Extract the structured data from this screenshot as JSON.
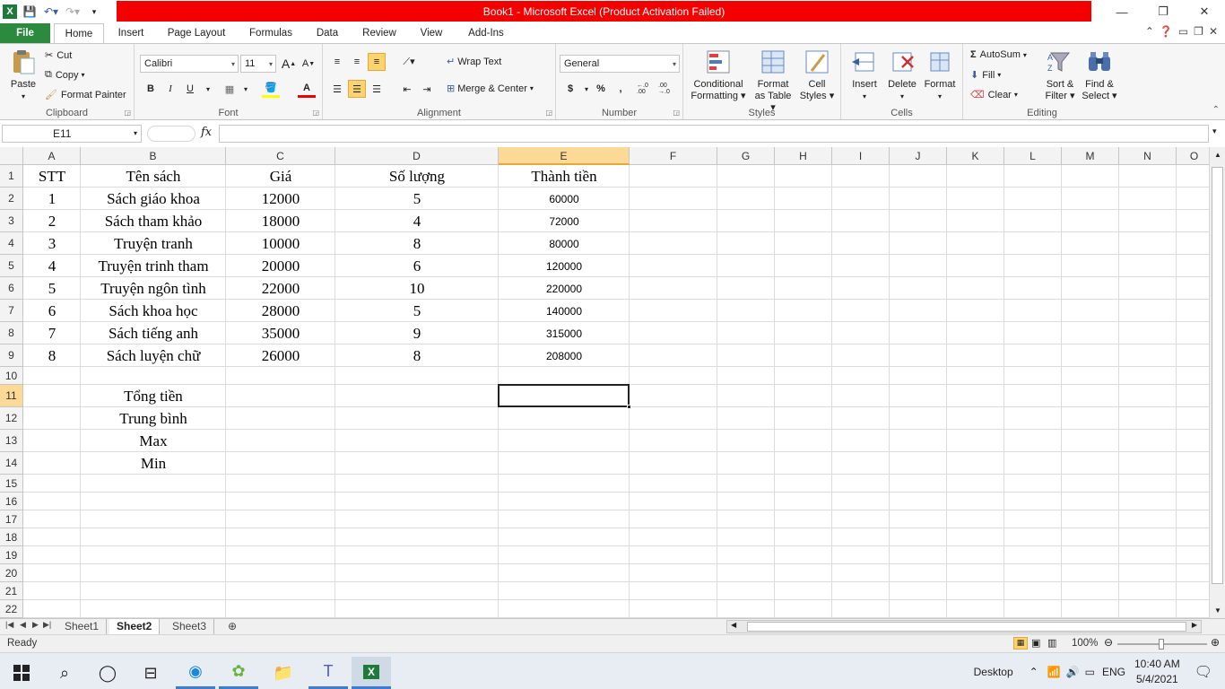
{
  "window": {
    "title": "Book1 - Microsoft Excel (Product Activation Failed)",
    "title_bar_color": "#f40000",
    "minimize": "—",
    "restore": "❐",
    "close": "✕"
  },
  "ribbon_tabs": [
    "File",
    "Home",
    "Insert",
    "Page Layout",
    "Formulas",
    "Data",
    "Review",
    "View",
    "Add-Ins"
  ],
  "active_tab": "Home",
  "clipboard": {
    "label": "Clipboard",
    "paste": "Paste",
    "cut": "Cut",
    "copy": "Copy",
    "format_painter": "Format Painter"
  },
  "font": {
    "label": "Font",
    "name": "Calibri",
    "size": "11",
    "bold": "B",
    "italic": "I",
    "underline": "U",
    "grow": "A",
    "shrink": "A",
    "font_color": "A"
  },
  "alignment": {
    "label": "Alignment",
    "wrap_text": "Wrap Text",
    "merge_center": "Merge & Center"
  },
  "number": {
    "label": "Number",
    "format": "General",
    "currency": "$",
    "percent": "%",
    "comma": ",",
    "inc_decimal": "←.0 .00",
    "dec_decimal": ".00 →.0"
  },
  "styles": {
    "label": "Styles",
    "conditional": [
      "Conditional",
      "Formatting"
    ],
    "format_table": [
      "Format",
      "as Table"
    ],
    "cell_styles": [
      "Cell",
      "Styles"
    ]
  },
  "cells": {
    "label": "Cells",
    "insert": "Insert",
    "delete": "Delete",
    "format": "Format"
  },
  "editing": {
    "label": "Editing",
    "autosum": "AutoSum",
    "fill": "Fill",
    "clear": "Clear",
    "sort_filter": [
      "Sort &",
      "Filter"
    ],
    "find_select": [
      "Find &",
      "Select"
    ]
  },
  "formula_bar": {
    "name_box": "E11",
    "fx": "fx",
    "formula": ""
  },
  "columns": [
    "A",
    "B",
    "C",
    "D",
    "E",
    "F",
    "G",
    "H",
    "I",
    "J",
    "K",
    "L",
    "M",
    "N",
    "O"
  ],
  "active_column": "E",
  "rows": [
    "1",
    "2",
    "3",
    "4",
    "5",
    "6",
    "7",
    "8",
    "9",
    "10",
    "11",
    "12",
    "13",
    "14",
    "15",
    "16",
    "17",
    "18",
    "19",
    "20",
    "21",
    "22"
  ],
  "active_row": "11",
  "sheet": {
    "header": [
      "STT",
      "Tên sách",
      "Giá",
      "Số lượng",
      "Thành tiền"
    ],
    "data": [
      [
        "1",
        "Sách giáo khoa",
        "12000",
        "5",
        "60000"
      ],
      [
        "2",
        "Sách tham khảo",
        "18000",
        "4",
        "72000"
      ],
      [
        "3",
        "Truyện tranh",
        "10000",
        "8",
        "80000"
      ],
      [
        "4",
        "Truyện trinh tham",
        "20000",
        "6",
        "120000"
      ],
      [
        "5",
        "Truyện ngôn tình",
        "22000",
        "10",
        "220000"
      ],
      [
        "6",
        "Sách khoa học",
        "28000",
        "5",
        "140000"
      ],
      [
        "7",
        "Sách tiếng anh",
        "35000",
        "9",
        "315000"
      ],
      [
        "8",
        "Sách luyện chữ",
        "26000",
        "8",
        "208000"
      ]
    ],
    "summary_labels": [
      "Tổng tiền",
      "Trung bình",
      "Max",
      "Min"
    ]
  },
  "sheet_tabs": [
    "Sheet1",
    "Sheet2",
    "Sheet3"
  ],
  "active_sheet": "Sheet2",
  "status": {
    "ready": "Ready",
    "zoom": "100%"
  },
  "taskbar": {
    "desktop": "Desktop",
    "language": "ENG",
    "time": "10:40 AM",
    "date": "5/4/2021"
  }
}
